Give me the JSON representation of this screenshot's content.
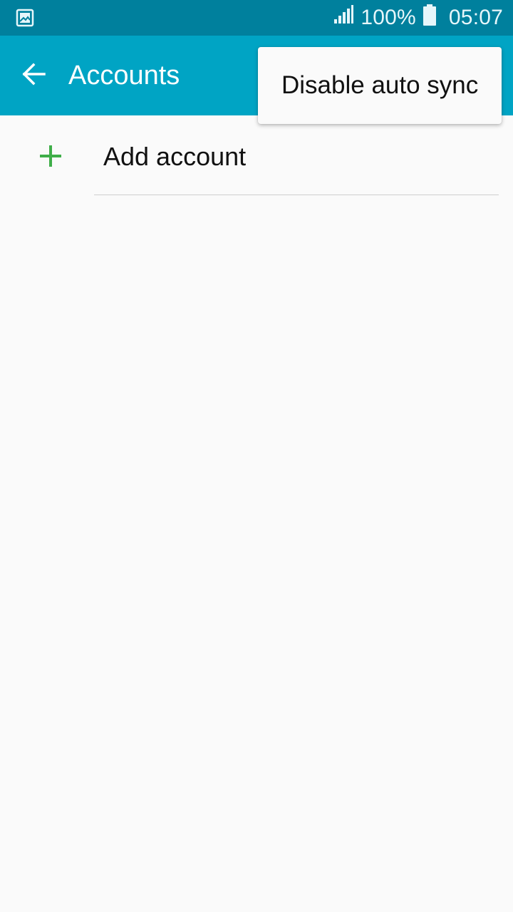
{
  "status_bar": {
    "left_icon": "gallery-notification-icon",
    "signal_icon": "cellular-signal-icon",
    "battery_percent": "100%",
    "battery_icon": "battery-full-icon",
    "time": "05:07"
  },
  "app_bar": {
    "back_icon": "arrow-back-icon",
    "title": "Accounts",
    "color": "#00a4c4"
  },
  "list": {
    "items": [
      {
        "icon": "plus-icon",
        "label": "Add account",
        "icon_color": "#3fae49"
      }
    ]
  },
  "overflow_menu": {
    "items": [
      {
        "label": "Disable auto sync"
      }
    ]
  }
}
